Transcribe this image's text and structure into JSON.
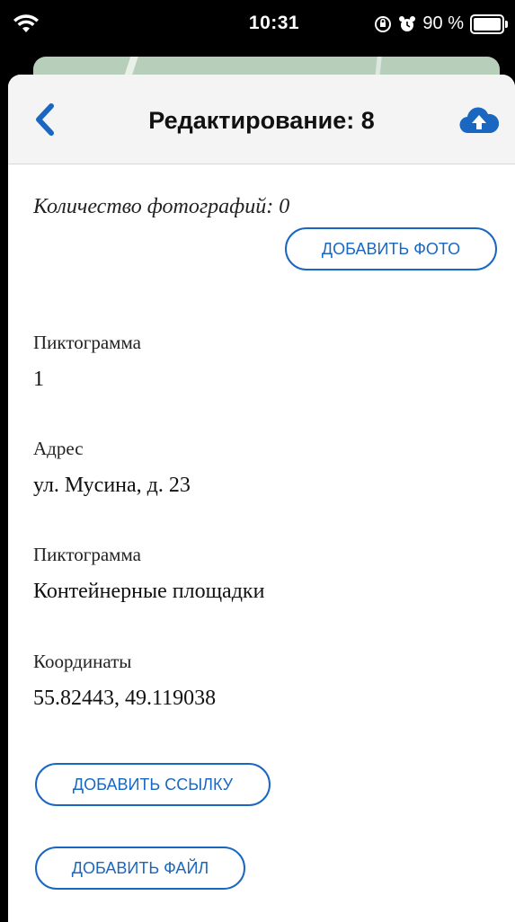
{
  "status_bar": {
    "time": "10:31",
    "battery": "90 %",
    "icons": [
      "wifi-icon",
      "orientation-lock-icon",
      "alarm-icon",
      "battery-icon"
    ]
  },
  "header": {
    "title": "Редактирование: 8",
    "back_icon": "chevron-left-icon",
    "upload_icon": "cloud-upload-icon",
    "accent": "#1a67c2"
  },
  "photos": {
    "count_text": "Количество фотографий: 0",
    "add_button": "ДОБАВИТЬ ФОТО"
  },
  "fields": [
    {
      "label": "Пиктограмма",
      "value": "1"
    },
    {
      "label": "Адрес",
      "value": "ул. Мусина, д. 23"
    },
    {
      "label": "Пиктограмма",
      "value": "Контейнерные площадки"
    },
    {
      "label": "Координаты",
      "value": "55.82443, 49.119038"
    }
  ],
  "actions": {
    "add_link": "ДОБАВИТЬ ССЫЛКУ",
    "add_file": "ДОБАВИТЬ ФАЙЛ"
  }
}
